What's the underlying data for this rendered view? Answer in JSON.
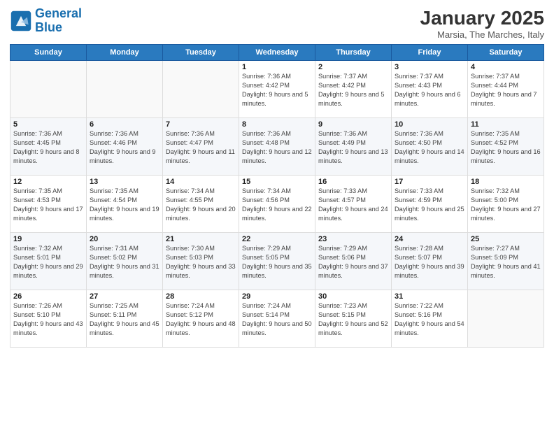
{
  "logo": {
    "line1": "General",
    "line2": "Blue"
  },
  "title": "January 2025",
  "subtitle": "Marsia, The Marches, Italy",
  "days_of_week": [
    "Sunday",
    "Monday",
    "Tuesday",
    "Wednesday",
    "Thursday",
    "Friday",
    "Saturday"
  ],
  "weeks": [
    [
      {
        "day": "",
        "info": ""
      },
      {
        "day": "",
        "info": ""
      },
      {
        "day": "",
        "info": ""
      },
      {
        "day": "1",
        "info": "Sunrise: 7:36 AM\nSunset: 4:42 PM\nDaylight: 9 hours and 5 minutes."
      },
      {
        "day": "2",
        "info": "Sunrise: 7:37 AM\nSunset: 4:42 PM\nDaylight: 9 hours and 5 minutes."
      },
      {
        "day": "3",
        "info": "Sunrise: 7:37 AM\nSunset: 4:43 PM\nDaylight: 9 hours and 6 minutes."
      },
      {
        "day": "4",
        "info": "Sunrise: 7:37 AM\nSunset: 4:44 PM\nDaylight: 9 hours and 7 minutes."
      }
    ],
    [
      {
        "day": "5",
        "info": "Sunrise: 7:36 AM\nSunset: 4:45 PM\nDaylight: 9 hours and 8 minutes."
      },
      {
        "day": "6",
        "info": "Sunrise: 7:36 AM\nSunset: 4:46 PM\nDaylight: 9 hours and 9 minutes."
      },
      {
        "day": "7",
        "info": "Sunrise: 7:36 AM\nSunset: 4:47 PM\nDaylight: 9 hours and 11 minutes."
      },
      {
        "day": "8",
        "info": "Sunrise: 7:36 AM\nSunset: 4:48 PM\nDaylight: 9 hours and 12 minutes."
      },
      {
        "day": "9",
        "info": "Sunrise: 7:36 AM\nSunset: 4:49 PM\nDaylight: 9 hours and 13 minutes."
      },
      {
        "day": "10",
        "info": "Sunrise: 7:36 AM\nSunset: 4:50 PM\nDaylight: 9 hours and 14 minutes."
      },
      {
        "day": "11",
        "info": "Sunrise: 7:35 AM\nSunset: 4:52 PM\nDaylight: 9 hours and 16 minutes."
      }
    ],
    [
      {
        "day": "12",
        "info": "Sunrise: 7:35 AM\nSunset: 4:53 PM\nDaylight: 9 hours and 17 minutes."
      },
      {
        "day": "13",
        "info": "Sunrise: 7:35 AM\nSunset: 4:54 PM\nDaylight: 9 hours and 19 minutes."
      },
      {
        "day": "14",
        "info": "Sunrise: 7:34 AM\nSunset: 4:55 PM\nDaylight: 9 hours and 20 minutes."
      },
      {
        "day": "15",
        "info": "Sunrise: 7:34 AM\nSunset: 4:56 PM\nDaylight: 9 hours and 22 minutes."
      },
      {
        "day": "16",
        "info": "Sunrise: 7:33 AM\nSunset: 4:57 PM\nDaylight: 9 hours and 24 minutes."
      },
      {
        "day": "17",
        "info": "Sunrise: 7:33 AM\nSunset: 4:59 PM\nDaylight: 9 hours and 25 minutes."
      },
      {
        "day": "18",
        "info": "Sunrise: 7:32 AM\nSunset: 5:00 PM\nDaylight: 9 hours and 27 minutes."
      }
    ],
    [
      {
        "day": "19",
        "info": "Sunrise: 7:32 AM\nSunset: 5:01 PM\nDaylight: 9 hours and 29 minutes."
      },
      {
        "day": "20",
        "info": "Sunrise: 7:31 AM\nSunset: 5:02 PM\nDaylight: 9 hours and 31 minutes."
      },
      {
        "day": "21",
        "info": "Sunrise: 7:30 AM\nSunset: 5:03 PM\nDaylight: 9 hours and 33 minutes."
      },
      {
        "day": "22",
        "info": "Sunrise: 7:29 AM\nSunset: 5:05 PM\nDaylight: 9 hours and 35 minutes."
      },
      {
        "day": "23",
        "info": "Sunrise: 7:29 AM\nSunset: 5:06 PM\nDaylight: 9 hours and 37 minutes."
      },
      {
        "day": "24",
        "info": "Sunrise: 7:28 AM\nSunset: 5:07 PM\nDaylight: 9 hours and 39 minutes."
      },
      {
        "day": "25",
        "info": "Sunrise: 7:27 AM\nSunset: 5:09 PM\nDaylight: 9 hours and 41 minutes."
      }
    ],
    [
      {
        "day": "26",
        "info": "Sunrise: 7:26 AM\nSunset: 5:10 PM\nDaylight: 9 hours and 43 minutes."
      },
      {
        "day": "27",
        "info": "Sunrise: 7:25 AM\nSunset: 5:11 PM\nDaylight: 9 hours and 45 minutes."
      },
      {
        "day": "28",
        "info": "Sunrise: 7:24 AM\nSunset: 5:12 PM\nDaylight: 9 hours and 48 minutes."
      },
      {
        "day": "29",
        "info": "Sunrise: 7:24 AM\nSunset: 5:14 PM\nDaylight: 9 hours and 50 minutes."
      },
      {
        "day": "30",
        "info": "Sunrise: 7:23 AM\nSunset: 5:15 PM\nDaylight: 9 hours and 52 minutes."
      },
      {
        "day": "31",
        "info": "Sunrise: 7:22 AM\nSunset: 5:16 PM\nDaylight: 9 hours and 54 minutes."
      },
      {
        "day": "",
        "info": ""
      }
    ]
  ]
}
